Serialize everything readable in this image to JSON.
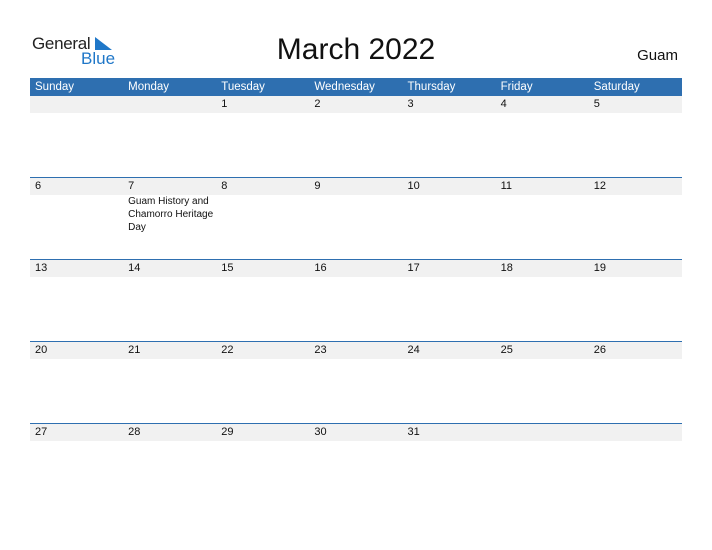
{
  "logo": {
    "general": "General",
    "blue": "Blue"
  },
  "title": "March 2022",
  "region": "Guam",
  "colors": {
    "header_bg": "#2e6fb0",
    "band_bg": "#f1f1f1",
    "brand_blue": "#1f77c8"
  },
  "weekdays": [
    "Sunday",
    "Monday",
    "Tuesday",
    "Wednesday",
    "Thursday",
    "Friday",
    "Saturday"
  ],
  "weeks": [
    {
      "days": [
        "",
        "",
        "1",
        "2",
        "3",
        "4",
        "5"
      ]
    },
    {
      "days": [
        "6",
        "7",
        "8",
        "9",
        "10",
        "11",
        "12"
      ]
    },
    {
      "days": [
        "13",
        "14",
        "15",
        "16",
        "17",
        "18",
        "19"
      ]
    },
    {
      "days": [
        "20",
        "21",
        "22",
        "23",
        "24",
        "25",
        "26"
      ]
    },
    {
      "days": [
        "27",
        "28",
        "29",
        "30",
        "31",
        "",
        ""
      ]
    }
  ],
  "events": [
    {
      "date": "7",
      "week": 1,
      "weekday": 1,
      "label": "Guam History and Chamorro Heritage Day"
    }
  ]
}
